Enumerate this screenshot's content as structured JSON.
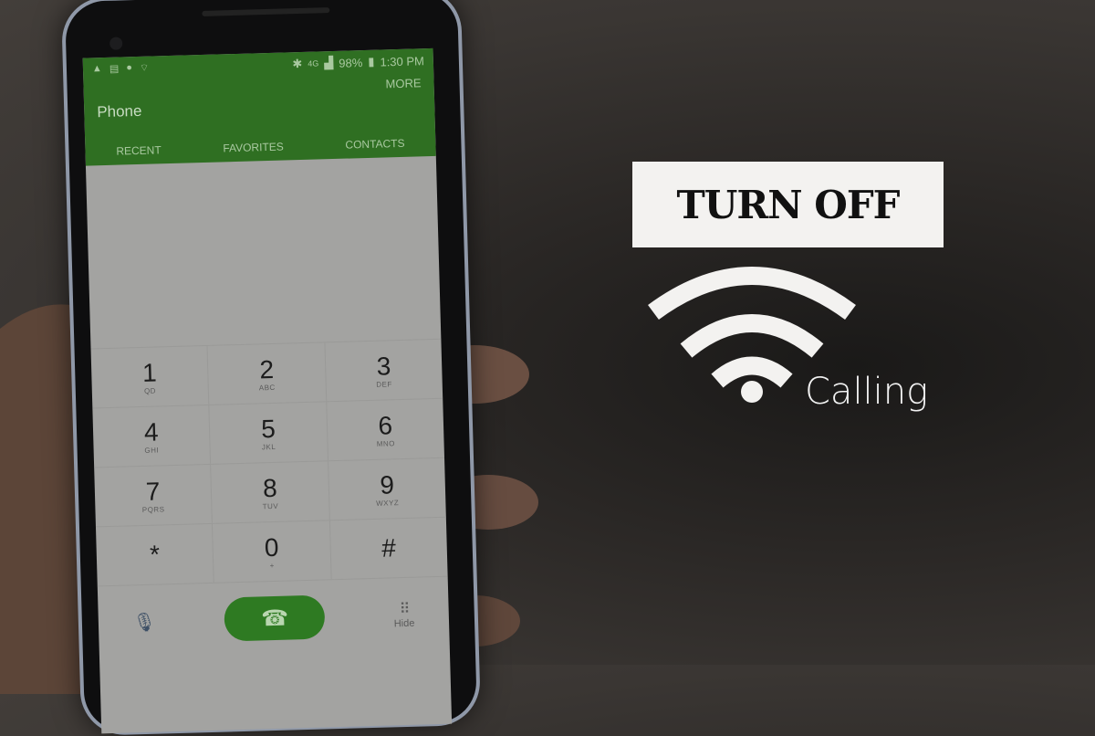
{
  "phone": {
    "status_bar": {
      "left_icons": [
        "alert-icon",
        "message-icon",
        "sync-icon",
        "wifi-calling-icon"
      ],
      "right_icons": [
        "bluetooth-icon",
        "4g-icon",
        "signal-icon"
      ],
      "battery": "98%",
      "time": "1:30 PM"
    },
    "app_title": "Phone",
    "more_label": "MORE",
    "tabs": [
      {
        "label": "RECENT"
      },
      {
        "label": "FAVORITES"
      },
      {
        "label": "CONTACTS"
      }
    ],
    "keypad": [
      [
        {
          "digit": "1",
          "letters": "QD"
        },
        {
          "digit": "2",
          "letters": "ABC"
        },
        {
          "digit": "3",
          "letters": "DEF"
        }
      ],
      [
        {
          "digit": "4",
          "letters": "GHI"
        },
        {
          "digit": "5",
          "letters": "JKL"
        },
        {
          "digit": "6",
          "letters": "MNO"
        }
      ],
      [
        {
          "digit": "7",
          "letters": "PQRS"
        },
        {
          "digit": "8",
          "letters": "TUV"
        },
        {
          "digit": "9",
          "letters": "WXYZ"
        }
      ],
      [
        {
          "digit": "*",
          "letters": ""
        },
        {
          "digit": "0",
          "letters": "+"
        },
        {
          "digit": "#",
          "letters": ""
        }
      ]
    ],
    "bottom": {
      "call_icon": "☎",
      "hide_label": "Hide"
    },
    "colors": {
      "accent": "#2f6f22"
    }
  },
  "overlay": {
    "banner": "TURN OFF",
    "calling": "Calling"
  }
}
